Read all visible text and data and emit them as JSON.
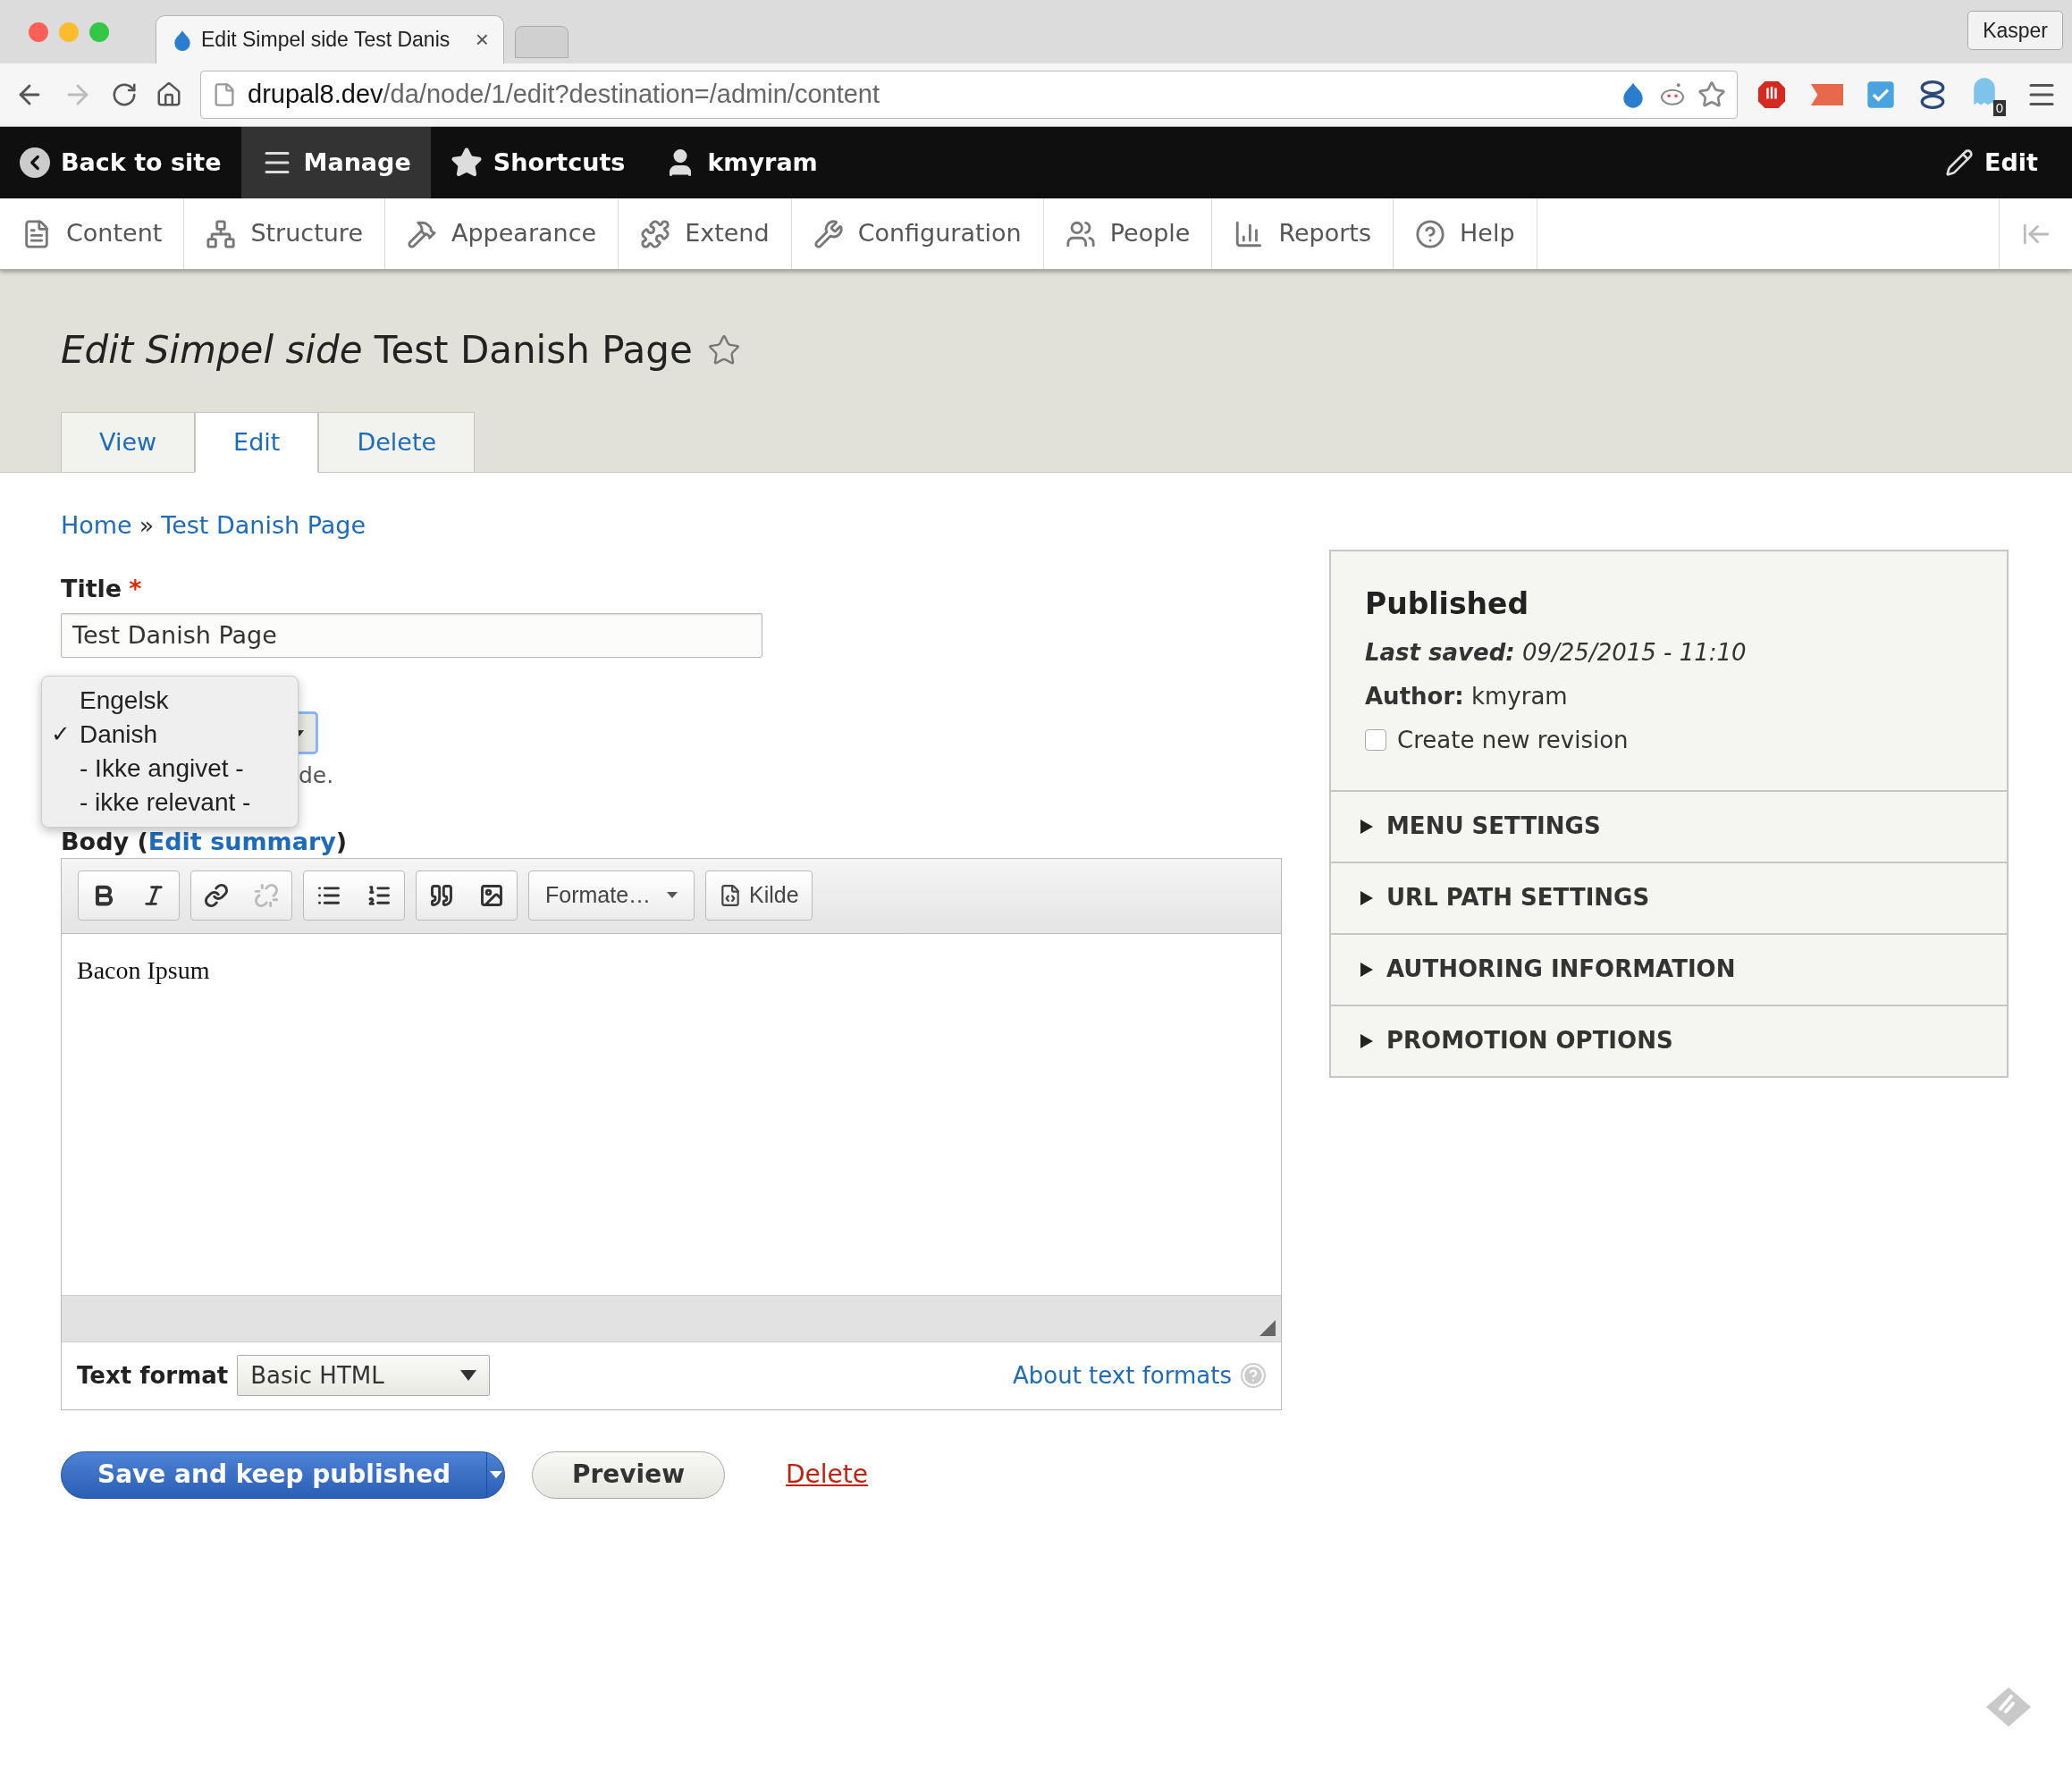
{
  "browser": {
    "tab_title": "Edit Simpel side Test Danis",
    "tab_close": "×",
    "profile": "Kasper",
    "url_host": "drupal8.dev",
    "url_path": "/da/node/1/edit?destination=/admin/content",
    "badge": "0"
  },
  "toolbar": {
    "items": [
      {
        "label": "Back to site",
        "selected": false
      },
      {
        "label": "Manage",
        "selected": true
      },
      {
        "label": "Shortcuts",
        "selected": false
      },
      {
        "label": "kmyram",
        "selected": false
      }
    ],
    "edit": "Edit"
  },
  "tray": {
    "items": [
      "Content",
      "Structure",
      "Appearance",
      "Extend",
      "Configuration",
      "People",
      "Reports",
      "Help"
    ]
  },
  "header": {
    "title_type": "Edit Simpel side",
    "title_name": "Test Danish Page",
    "tabs": [
      {
        "label": "View",
        "selected": false
      },
      {
        "label": "Edit",
        "selected": true
      },
      {
        "label": "Delete",
        "selected": false
      }
    ]
  },
  "breadcrumb": {
    "items": [
      "Home",
      "Test Danish Page"
    ],
    "separator": "»"
  },
  "form": {
    "title_label": "Title",
    "required_mark": "*",
    "title_value": "Test Danish Page",
    "language_menu": {
      "check_mark": "✓",
      "options": [
        {
          "label": "Engelsk",
          "selected": false
        },
        {
          "label": "Danish",
          "selected": true
        },
        {
          "label": "- Ikke angivet -",
          "selected": false
        },
        {
          "label": "- ikke relevant -",
          "selected": false
        }
      ]
    },
    "description_tail": "de.",
    "body_label": "Body (",
    "body_link": "Edit summary",
    "body_label_end": ")",
    "editor_toolbar": [
      {
        "buttons": [
          {
            "kind": "bold",
            "disabled": false
          },
          {
            "kind": "italic",
            "disabled": false
          }
        ]
      },
      {
        "buttons": [
          {
            "kind": "link",
            "disabled": false
          },
          {
            "kind": "unlink",
            "disabled": true
          }
        ]
      },
      {
        "buttons": [
          {
            "kind": "bulleted",
            "disabled": false
          },
          {
            "kind": "numbered",
            "disabled": false
          }
        ]
      },
      {
        "buttons": [
          {
            "kind": "quote",
            "disabled": false
          },
          {
            "kind": "image",
            "disabled": false
          }
        ]
      }
    ],
    "format_dropdown": "Formate…",
    "source_button": "Kilde",
    "body_text": "Bacon Ipsum",
    "text_format_label": "Text format",
    "text_format_value": "Basic HTML",
    "about_link": "About text formats"
  },
  "actions": {
    "save": "Save and keep published",
    "preview": "Preview",
    "delete": "Delete"
  },
  "sidebar": {
    "status": "Published",
    "last_saved_label": "Last saved:",
    "last_saved_value": "09/25/2015 - 11:10",
    "author_label": "Author:",
    "author_value": "kmyram",
    "revision": {
      "label": "Create new revision",
      "checked": false
    },
    "sections": [
      {
        "label": "MENU SETTINGS",
        "expanded": false
      },
      {
        "label": "URL PATH SETTINGS",
        "expanded": false
      },
      {
        "label": "AUTHORING INFORMATION",
        "expanded": false
      },
      {
        "label": "PROMOTION OPTIONS",
        "expanded": false
      }
    ]
  }
}
